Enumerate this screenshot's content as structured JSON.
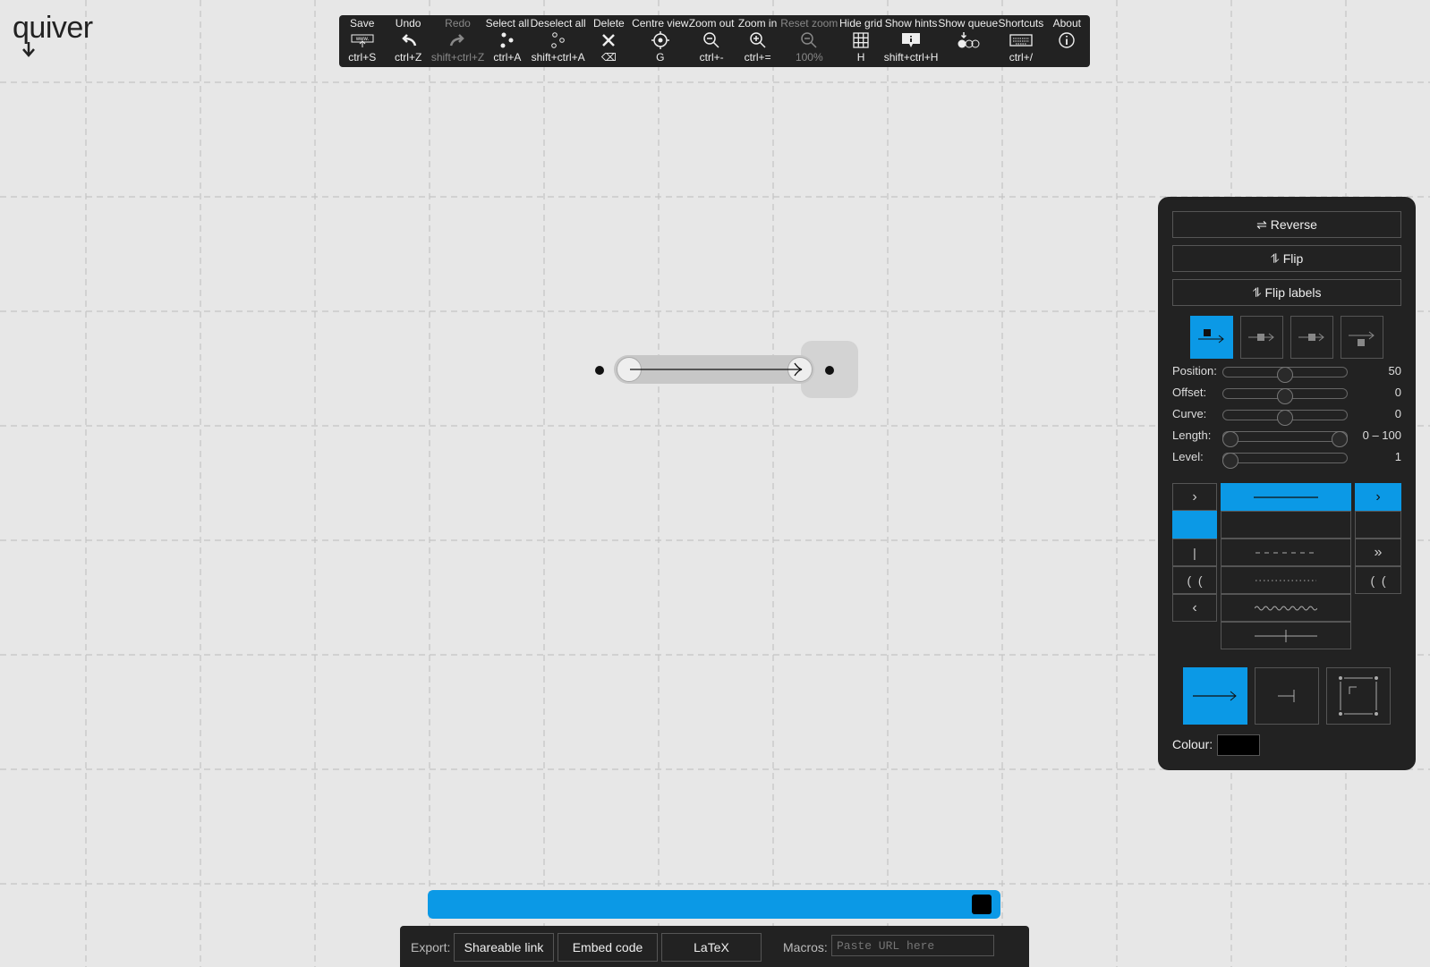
{
  "app": {
    "logo_text": "quiver"
  },
  "toolbar": [
    {
      "label": "Save",
      "shortcut": "ctrl+S",
      "icon": "save-icon",
      "disabled": false
    },
    {
      "label": "Undo",
      "shortcut": "ctrl+Z",
      "icon": "undo-icon",
      "disabled": false
    },
    {
      "label": "Redo",
      "shortcut": "shift+ctrl+Z",
      "icon": "redo-icon",
      "disabled": true
    },
    {
      "label": "Select all",
      "shortcut": "ctrl+A",
      "icon": "select-all-icon",
      "disabled": false
    },
    {
      "label": "Deselect all",
      "shortcut": "shift+ctrl+A",
      "icon": "deselect-all-icon",
      "disabled": false
    },
    {
      "label": "Delete",
      "shortcut": "⌫",
      "icon": "delete-icon",
      "disabled": false
    },
    {
      "label": "Centre view",
      "shortcut": "G",
      "icon": "centre-view-icon",
      "disabled": false
    },
    {
      "label": "Zoom out",
      "shortcut": "ctrl+-",
      "icon": "zoom-out-icon",
      "disabled": false
    },
    {
      "label": "Zoom in",
      "shortcut": "ctrl+=",
      "icon": "zoom-in-icon",
      "disabled": false
    },
    {
      "label": "Reset zoom",
      "shortcut": "100%",
      "icon": "reset-zoom-icon",
      "disabled": true
    },
    {
      "label": "Hide grid",
      "shortcut": "H",
      "icon": "grid-icon",
      "disabled": false
    },
    {
      "label": "Show hints",
      "shortcut": "shift+ctrl+H",
      "icon": "hints-icon",
      "disabled": false
    },
    {
      "label": "Show queue",
      "shortcut": "",
      "icon": "queue-icon",
      "disabled": false
    },
    {
      "label": "Shortcuts",
      "shortcut": "ctrl+/",
      "icon": "keyboard-icon",
      "disabled": false
    },
    {
      "label": "About",
      "shortcut": "",
      "icon": "info-icon",
      "disabled": false
    }
  ],
  "panel": {
    "reverse_label": "⇌ Reverse",
    "flip_label": "⥮ Flip",
    "flip_labels_label": "⥮ Flip labels",
    "label_alignment_selected": "left",
    "sliders": [
      {
        "label": "Position:",
        "value": "50",
        "fraction": 0.5
      },
      {
        "label": "Offset:",
        "value": "0",
        "fraction": 0.5
      },
      {
        "label": "Curve:",
        "value": "0",
        "fraction": 0.5
      },
      {
        "label": "Length:",
        "value": "0 – 100",
        "fraction": 0.0,
        "fraction2": 1.0
      },
      {
        "label": "Level:",
        "value": "1",
        "fraction": 0.0
      }
    ],
    "tail_style_selected": "none",
    "body_style_selected": "solid",
    "head_style_selected": "arrowhead",
    "edge_type_selected": "arrow",
    "colour_label": "Colour:",
    "colour_value": "#000000"
  },
  "export": {
    "label": "Export:",
    "shareable_link": "Shareable link",
    "embed_code": "Embed code",
    "latex": "LaTeX",
    "macros_label": "Macros:",
    "macros_placeholder": "Paste URL here"
  },
  "colors": {
    "accent": "#0b99e6",
    "panel_bg": "#222222",
    "canvas_bg": "#e7e7e7"
  }
}
